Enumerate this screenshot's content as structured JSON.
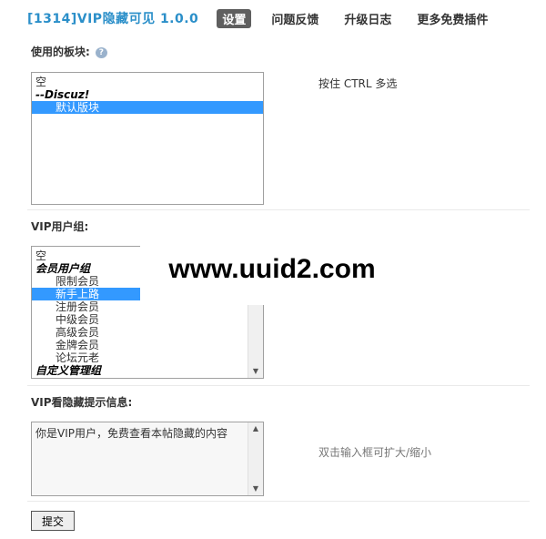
{
  "header": {
    "title": "[1314]VIP隐藏可见 1.0.0",
    "tabs": [
      {
        "label": "设置",
        "active": true
      },
      {
        "label": "问题反馈",
        "active": false
      },
      {
        "label": "升级日志",
        "active": false
      },
      {
        "label": "更多免费插件",
        "active": false
      }
    ]
  },
  "forum_section": {
    "label": "使用的板块:",
    "hint": "按住 CTRL 多选",
    "options": [
      {
        "text": "空",
        "type": "normal",
        "selected": false
      },
      {
        "text": "--Discuz!",
        "type": "group",
        "selected": false
      },
      {
        "text": "默认版块",
        "type": "indent",
        "selected": true
      }
    ]
  },
  "vip_group_section": {
    "label": "VIP用户组:",
    "options": [
      {
        "text": "空",
        "type": "normal",
        "selected": false
      },
      {
        "text": "会员用户组",
        "type": "group",
        "selected": false
      },
      {
        "text": "限制会员",
        "type": "indent",
        "selected": false
      },
      {
        "text": "新手上路",
        "type": "indent",
        "selected": true
      },
      {
        "text": "注册会员",
        "type": "indent",
        "selected": false
      },
      {
        "text": "中级会员",
        "type": "indent",
        "selected": false
      },
      {
        "text": "高级会员",
        "type": "indent",
        "selected": false
      },
      {
        "text": "金牌会员",
        "type": "indent",
        "selected": false
      },
      {
        "text": "论坛元老",
        "type": "indent",
        "selected": false
      },
      {
        "text": "自定义管理组",
        "type": "group",
        "selected": false
      }
    ]
  },
  "message_section": {
    "label": "VIP看隐藏提示信息:",
    "value": "你是VIP用户，免费查看本帖隐藏的内容",
    "hint": "双击输入框可扩大/缩小"
  },
  "submit_label": "提交",
  "watermark": "www.uuid2.com",
  "colors": {
    "title": "#2b8fc9",
    "active_tab_bg": "#5f5f5f",
    "selection": "#3399ff"
  }
}
